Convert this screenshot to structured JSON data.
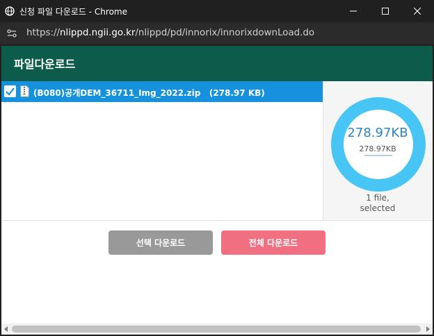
{
  "window": {
    "title": "신청 파일 다운로드 - Chrome",
    "url_scheme": "https://",
    "url_host": "nlippd.ngii.go.kr",
    "url_path": "/nlippd/pd/innorix/innorixdownLoad.do"
  },
  "header": {
    "title": "파일다운로드"
  },
  "file_list": [
    {
      "name": "(B080)공개DEM_36711_Img_2022.zip",
      "size": "(278.97 KB)",
      "checked": true
    }
  ],
  "summary": {
    "size_large": "278.97KB",
    "size_small": "278.97KB",
    "file_count": "1 file,",
    "status": "selected",
    "progress": 1.0
  },
  "buttons": {
    "download_selected": "선택 다운로드",
    "download_all": "전체 다운로드"
  },
  "colors": {
    "header_bg": "#0d5b4a",
    "row_selected": "#1591dd",
    "donut": "#47c6f5",
    "btn_selected": "#999999",
    "btn_all": "#f07082"
  },
  "icons": {
    "title": "globe-icon",
    "site_info": "tune-icon",
    "file": "zip-file-icon",
    "check": "check-icon",
    "minimize": "minimize-icon",
    "maximize": "maximize-icon",
    "close": "close-icon"
  }
}
